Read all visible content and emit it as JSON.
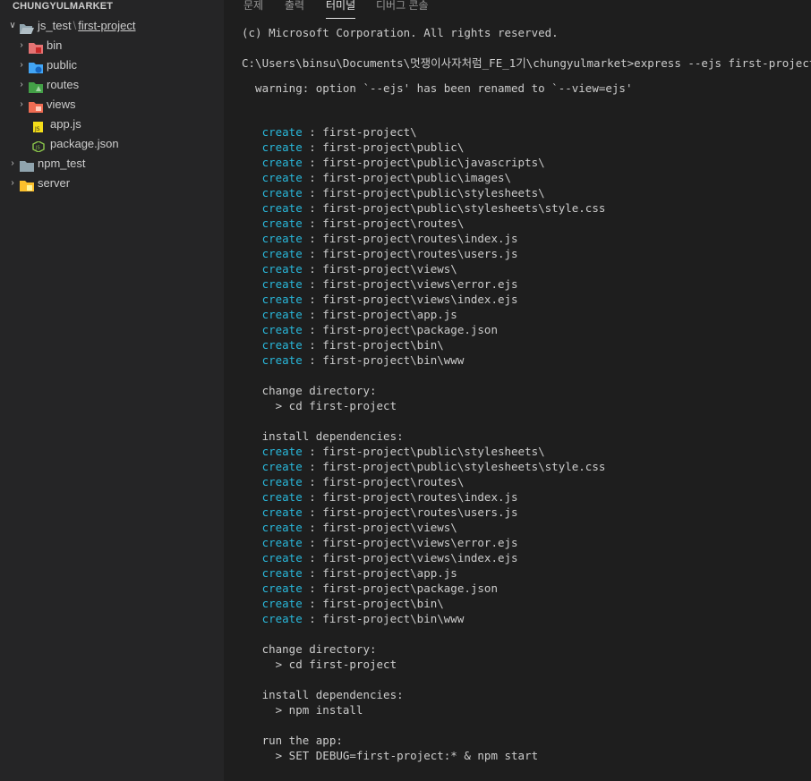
{
  "explorer": {
    "title": "CHUNGYULMARKET",
    "items": [
      {
        "label": "js_test",
        "label2": "first-project",
        "chevron": "expanded",
        "icon": "folder-open-icon",
        "color": "#c09553"
      },
      {
        "label": "bin",
        "chevron": "collapsed",
        "icon": "folder-bin-icon",
        "color": "#e06c75"
      },
      {
        "label": "public",
        "chevron": "collapsed",
        "icon": "folder-public-icon",
        "color": "#3d8ee0"
      },
      {
        "label": "routes",
        "chevron": "collapsed",
        "icon": "folder-routes-icon",
        "color": "#4caf50"
      },
      {
        "label": "views",
        "chevron": "collapsed",
        "icon": "folder-views-icon",
        "color": "#ef6c53"
      },
      {
        "label": "app.js",
        "chevron": "",
        "icon": "js-file-icon",
        "color": "#f5de19"
      },
      {
        "label": "package.json",
        "chevron": "",
        "icon": "nodejs-file-icon",
        "color": "#8cc84b"
      },
      {
        "label": "npm_test",
        "chevron": "collapsed",
        "icon": "folder-icon",
        "color": "#90a4ae"
      },
      {
        "label": "server",
        "chevron": "collapsed",
        "icon": "folder-server-icon",
        "color": "#f9c23c"
      }
    ]
  },
  "tabs": [
    "문제",
    "출력",
    "터미널",
    "디버그 콘솔"
  ],
  "active_tab": "터미널",
  "terminal": {
    "create_word": "create",
    "header": [
      "(c) Microsoft Corporation. All rights reserved.",
      "C:\\Users\\binsu\\Documents\\멋쟁이사자처럼_FE_1기\\chungyulmarket>express --ejs first-project",
      "  warning: option `--ejs' has been renamed to `--view=ejs'"
    ],
    "create_block_1": [
      " : first-project\\",
      " : first-project\\public\\",
      " : first-project\\public\\javascripts\\",
      " : first-project\\public\\images\\",
      " : first-project\\public\\stylesheets\\",
      " : first-project\\public\\stylesheets\\style.css",
      " : first-project\\routes\\",
      " : first-project\\routes\\index.js",
      " : first-project\\routes\\users.js",
      " : first-project\\views\\",
      " : first-project\\views\\error.ejs",
      " : first-project\\views\\index.ejs",
      " : first-project\\app.js",
      " : first-project\\package.json",
      " : first-project\\bin\\",
      " : first-project\\bin\\www"
    ],
    "change_dir_label": "   change directory:",
    "change_dir_cmd": "     > cd first-project",
    "install_label": "   install dependencies:",
    "create_block_2": [
      " : first-project\\public\\stylesheets\\",
      " : first-project\\public\\stylesheets\\style.css",
      " : first-project\\routes\\",
      " : first-project\\routes\\index.js",
      " : first-project\\routes\\users.js",
      " : first-project\\views\\",
      " : first-project\\views\\error.ejs",
      " : first-project\\views\\index.ejs",
      " : first-project\\app.js",
      " : first-project\\package.json",
      " : first-project\\bin\\",
      " : first-project\\bin\\www"
    ],
    "install_cmd": "     > npm install",
    "run_label": "   run the app:",
    "run_cmd": "     > SET DEBUG=first-project:* & npm start"
  }
}
